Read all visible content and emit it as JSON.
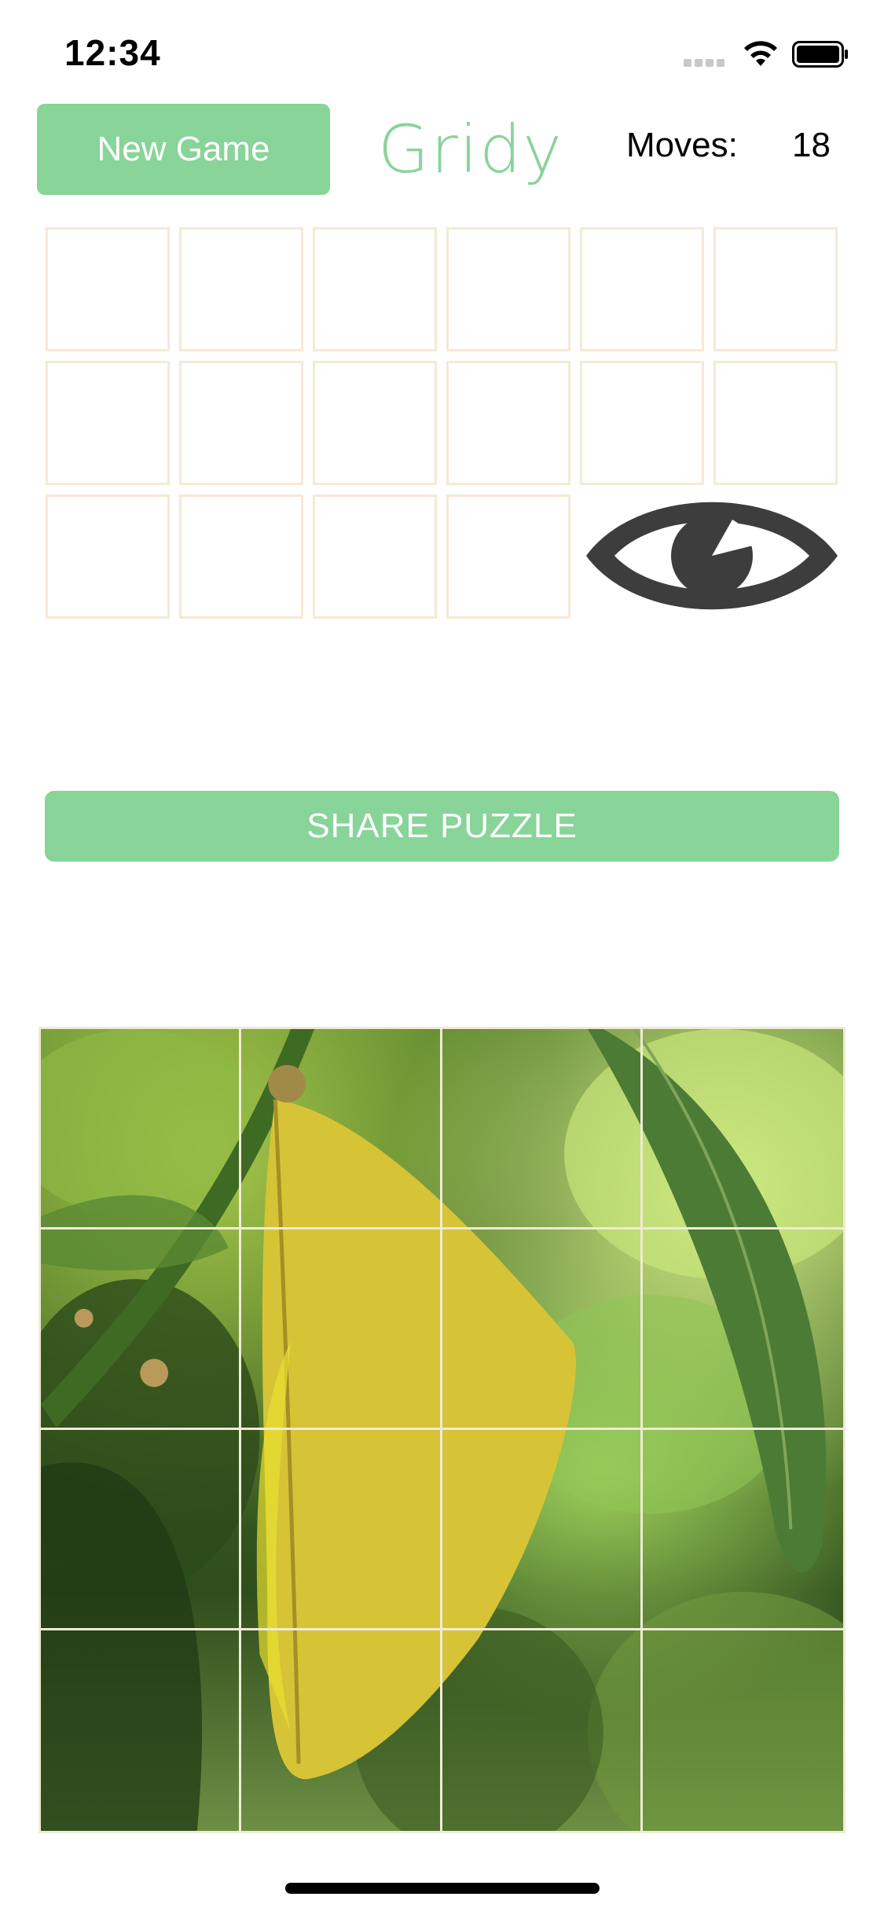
{
  "status_bar": {
    "time": "12:34"
  },
  "header": {
    "new_game_label": "New Game",
    "logo_text": "Gridy",
    "moves_label": "Moves:",
    "moves_value": "18"
  },
  "slots": {
    "rows": 3,
    "columns": 6,
    "empty_count": 16
  },
  "preview": {
    "icon": "eye-icon"
  },
  "share": {
    "label": "SHARE PUZZLE"
  },
  "board": {
    "rows": 4,
    "columns": 4,
    "image": "green-lemon-leaf-photo"
  },
  "colors": {
    "accent": "#88d499",
    "slot_border": "#f4ead6",
    "eye_icon": "#3d3d3d"
  }
}
